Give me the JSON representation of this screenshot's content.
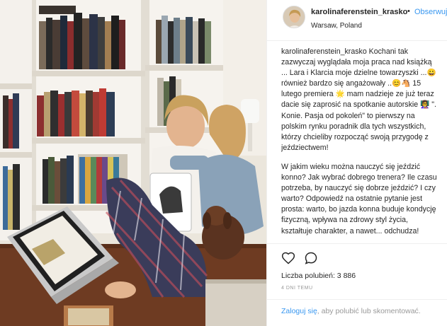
{
  "post": {
    "username": "karolinaferenstein_krasko",
    "follow_label": "Obserwuj",
    "location": "Warsaw, Poland",
    "caption": "Kochani tak zazwyczaj wyglądała moja praca nad książką ... Lara i Klarcia moje dzielne towarzyszki ...😀 również bardzo się angażowały ..😊🐴 15 lutego premiera 🌟 mam nadzieje ze już teraz dacie się zaprosić na spotkanie autorskie 👩‍🏫 \". Konie. Pasja od pokoleń\" to pierwszy na polskim rynku poradnik dla tych wszystkich, którzy chcieliby rozpocząć swoją przygodę z jeździectwem!",
    "caption_more": "W jakim wieku można nauczyć się jeździć konno? Jak wybrać dobrego trenera? Ile czasu potrzeba, by nauczyć się dobrze jeździć? I czy warto? Odpowiedź na ostatnie pytanie jest prosta: warto, bo jazda konna buduje kondycję fizyczną, wpływa na zdrowy styl życia, kształtuje charakter, a nawet... odchudza!",
    "likes_label": "Liczba polubień: 3 886",
    "date_label": "4 DNI TEMU",
    "login_link": "Zaloguj się",
    "login_text": ", aby polubić lub skomentować."
  },
  "icons": {
    "like": "heart-icon",
    "comment": "comment-icon"
  },
  "colors": {
    "link": "#3897f0",
    "text": "#262626",
    "muted": "#999999"
  }
}
